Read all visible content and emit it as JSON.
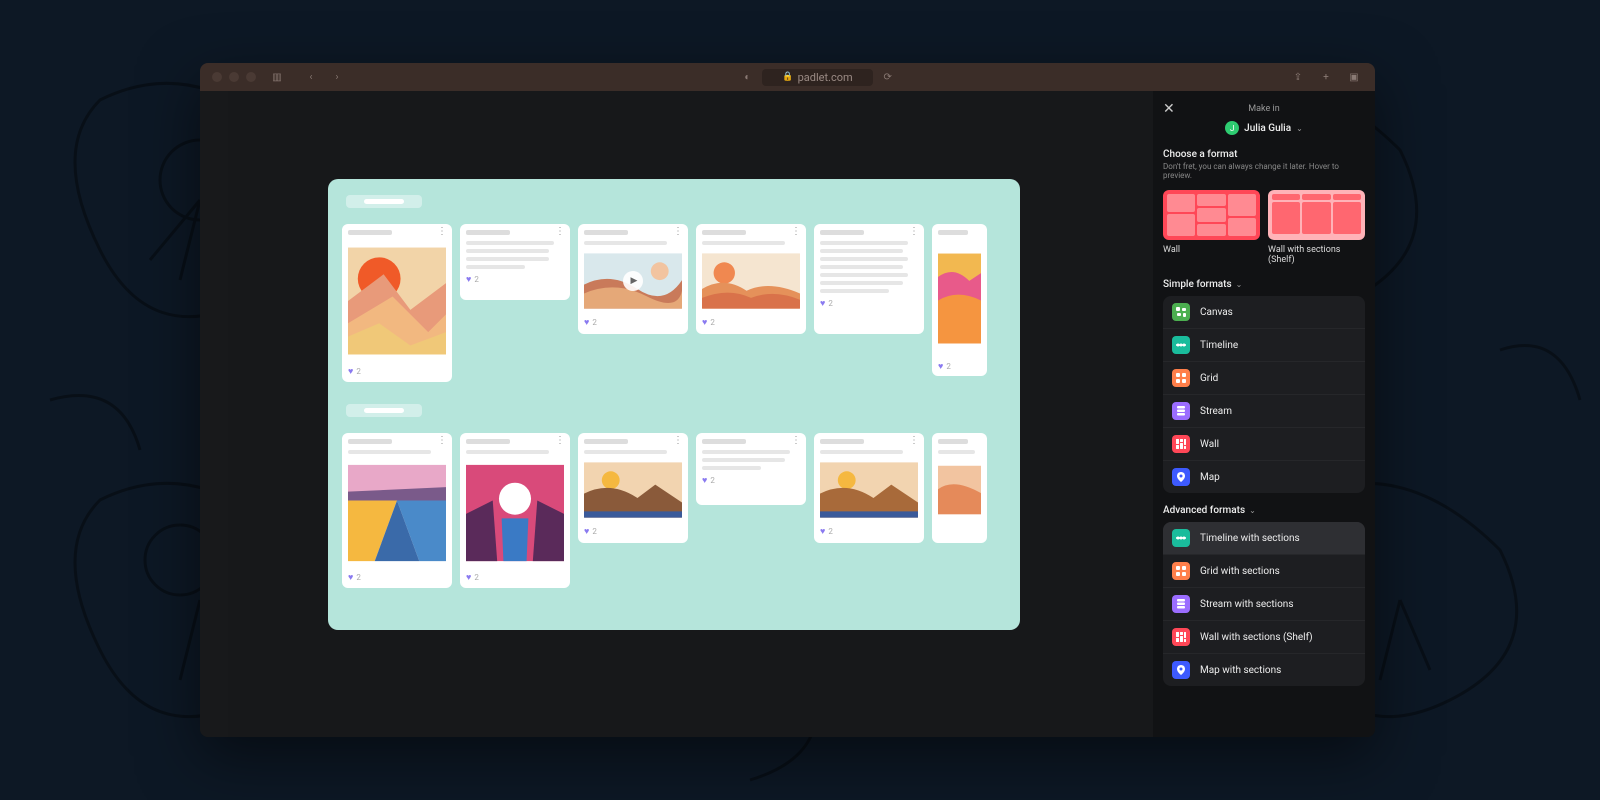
{
  "browser": {
    "url": "padlet.com"
  },
  "panel": {
    "make_in": "Make in",
    "user": "Julia Gulia",
    "user_initial": "J",
    "choose_title": "Choose a format",
    "choose_hint": "Don't fret, you can always change it later. Hover to preview.",
    "top_formats": [
      {
        "name": "Wall",
        "kind": "wall"
      },
      {
        "name": "Wall with sections (Shelf)",
        "kind": "shelf"
      }
    ],
    "simple_label": "Simple formats",
    "simple_formats": [
      {
        "name": "Canvas",
        "icon": "canvas"
      },
      {
        "name": "Timeline",
        "icon": "timeline"
      },
      {
        "name": "Grid",
        "icon": "grid"
      },
      {
        "name": "Stream",
        "icon": "stream"
      },
      {
        "name": "Wall",
        "icon": "wall"
      },
      {
        "name": "Map",
        "icon": "map"
      }
    ],
    "advanced_label": "Advanced formats",
    "advanced_formats": [
      {
        "name": "Timeline with sections",
        "icon": "timeline",
        "selected": true
      },
      {
        "name": "Grid with sections",
        "icon": "grid"
      },
      {
        "name": "Stream with sections",
        "icon": "stream"
      },
      {
        "name": "Wall with sections (Shelf)",
        "icon": "wall"
      },
      {
        "name": "Map with sections",
        "icon": "map"
      }
    ]
  },
  "preview": {
    "like_count": "2"
  }
}
